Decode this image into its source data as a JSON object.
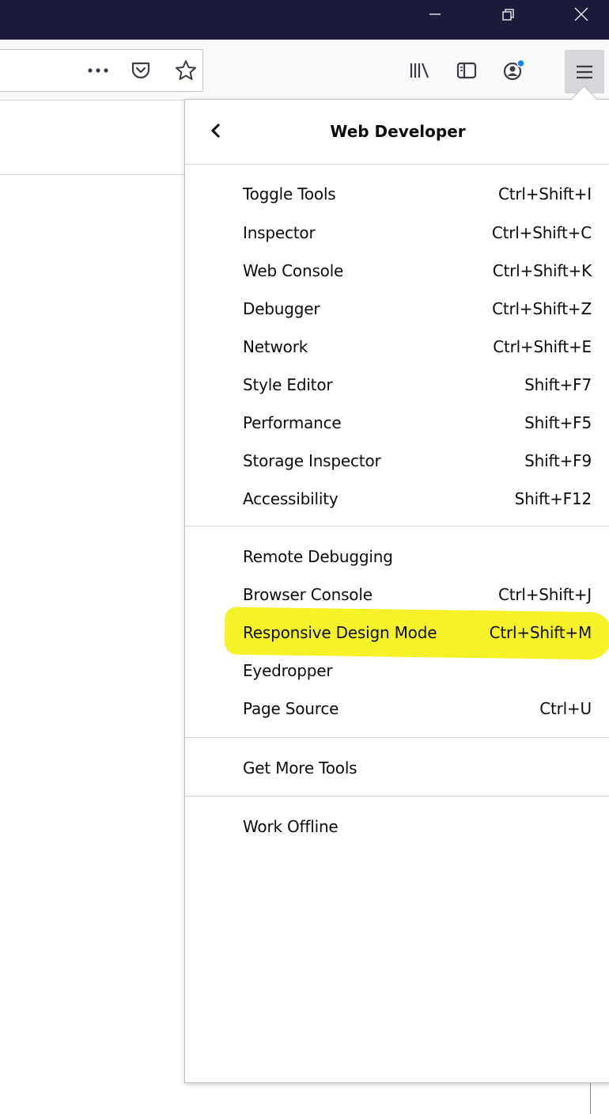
{
  "colors": {
    "titlebar": "#1c1b3a",
    "toolbar": "#f9f9fa",
    "highlight": "#f6f22a",
    "badge": "#0a84ff"
  },
  "toolbar": {
    "page_actions_icon": "more-horizontal-icon",
    "pocket_icon": "pocket-icon",
    "bookmark_icon": "star-icon",
    "library_icon": "library-icon",
    "sidebar_icon": "sidebar-icon",
    "account_icon": "account-icon",
    "menu_icon": "hamburger-menu-icon"
  },
  "panel": {
    "title": "Web Developer",
    "back_icon": "chevron-left-icon",
    "sections": [
      {
        "items": [
          {
            "label": "Toggle Tools",
            "shortcut": "Ctrl+Shift+I"
          },
          {
            "label": "Inspector",
            "shortcut": "Ctrl+Shift+C"
          },
          {
            "label": "Web Console",
            "shortcut": "Ctrl+Shift+K"
          },
          {
            "label": "Debugger",
            "shortcut": "Ctrl+Shift+Z"
          },
          {
            "label": "Network",
            "shortcut": "Ctrl+Shift+E"
          },
          {
            "label": "Style Editor",
            "shortcut": "Shift+F7"
          },
          {
            "label": "Performance",
            "shortcut": "Shift+F5"
          },
          {
            "label": "Storage Inspector",
            "shortcut": "Shift+F9"
          },
          {
            "label": "Accessibility",
            "shortcut": "Shift+F12"
          }
        ]
      },
      {
        "items": [
          {
            "label": "Remote Debugging",
            "shortcut": ""
          },
          {
            "label": "Browser Console",
            "shortcut": "Ctrl+Shift+J"
          },
          {
            "label": "Responsive Design Mode",
            "shortcut": "Ctrl+Shift+M",
            "highlighted": true
          },
          {
            "label": "Eyedropper",
            "shortcut": ""
          },
          {
            "label": "Page Source",
            "shortcut": "Ctrl+U"
          }
        ]
      },
      {
        "items": [
          {
            "label": "Get More Tools",
            "shortcut": ""
          }
        ]
      },
      {
        "items": [
          {
            "label": "Work Offline",
            "shortcut": ""
          }
        ]
      }
    ]
  }
}
